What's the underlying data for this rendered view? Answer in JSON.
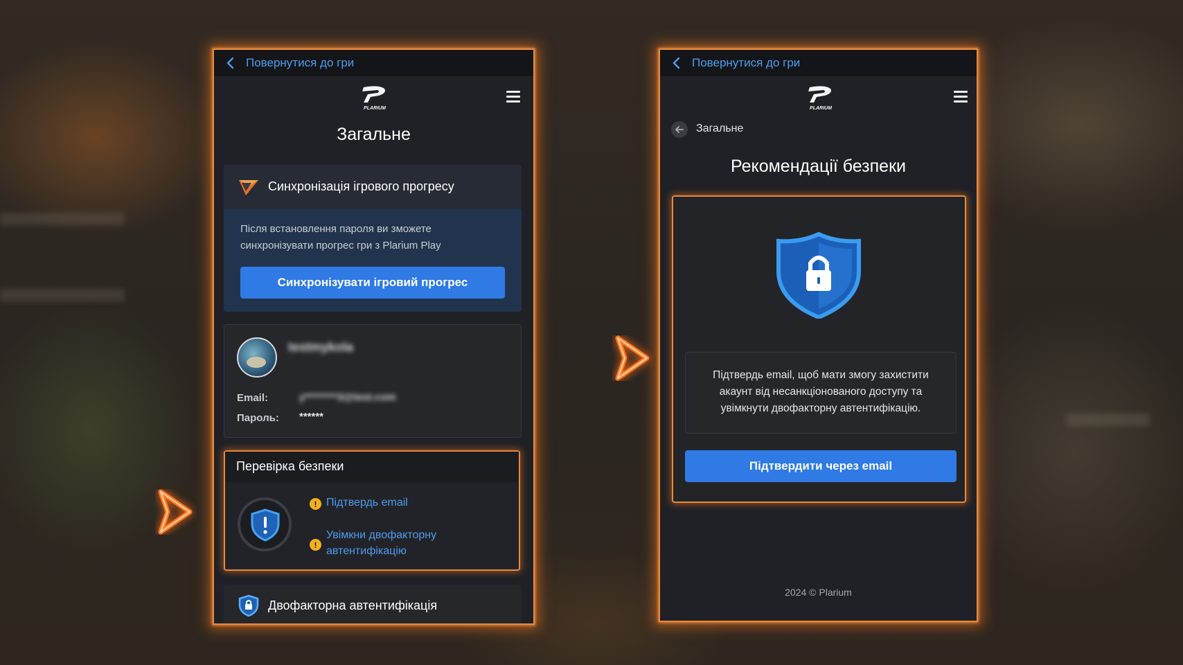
{
  "left_panel": {
    "back_label": "Повернутися до гри",
    "logo_text": "PLARIUM",
    "page_title": "Загальне",
    "sync_card": {
      "title": "Синхронізація ігрового прогресу",
      "description_line1": "Після встановлення пароля ви зможете",
      "description_line2": "синхронізувати прогрес гри з Plarium Play",
      "button_label": "Синхронізувати ігровий прогрес"
    },
    "account_card": {
      "username": "testmykola",
      "email_label": "Email:",
      "email_value": "y********3@test.com",
      "password_label": "Пароль:",
      "password_value": "******"
    },
    "security_card": {
      "title": "Перевірка безпеки",
      "item1": "Підтвердь email",
      "item2_line1": "Увімкни двофакторну",
      "item2_line2": "автентифікацію"
    },
    "twofa_card": {
      "title": "Двофакторна автентифікація"
    }
  },
  "right_panel": {
    "back_label": "Повернутися до гри",
    "logo_text": "PLARIUM",
    "breadcrumb": "Загальне",
    "page_title": "Рекомендації безпеки",
    "message_line1": "Підтвердь email, щоб мати змогу захистити",
    "message_line2": "акаунт від несанкціонованого доступу та",
    "message_line3": "увімкнути двофакторну автентифікацію.",
    "button_label": "Підтвердити через email",
    "footer": "2024 © Plarium"
  },
  "colors": {
    "accent_blue": "#2f7ae5",
    "link_blue": "#4d9cf0",
    "glow_orange": "#e98a3c",
    "warning_yellow": "#f2b01e"
  },
  "icons": [
    "chevron-left-icon",
    "plarium-logo",
    "hamburger-menu-icon",
    "shield-lock-icon",
    "shield-exclamation-icon",
    "warning-icon",
    "arrow-left-circle-icon",
    "chevron-right-arrow"
  ]
}
